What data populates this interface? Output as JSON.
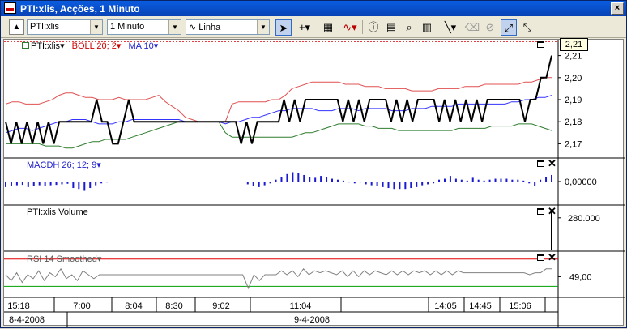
{
  "window": {
    "title": "PTI:xlis, Acções, 1 Minuto",
    "close_label": "×"
  },
  "toolbar": {
    "symbol": "PTI:xlis",
    "interval": "1 Minuto",
    "chart_style": "Linha",
    "chart_style_glyph": "∿"
  },
  "main_pane": {
    "legend": {
      "symbol": "PTI:xlis",
      "boll": "BOLL 20; 2",
      "ma": "MA 10"
    },
    "axis": [
      "2,21",
      "2,20",
      "2,19",
      "2,18",
      "2,17"
    ],
    "last_price": "2,21"
  },
  "macd_pane": {
    "legend": "MACDH 26; 12; 9",
    "axis": [
      "0,00000"
    ]
  },
  "volume_pane": {
    "legend": "PTI:xlis Volume",
    "axis": [
      "280.000"
    ]
  },
  "rsi_pane": {
    "legend": "RSI 14 Smoothed",
    "axis": [
      "49,00"
    ]
  },
  "time_axis": {
    "times": [
      "15:18",
      "7:00",
      "8:04",
      "8:30",
      "9:02",
      "11:04",
      "14:05",
      "14:45",
      "15:06"
    ],
    "dates": [
      "8-4-2008",
      "9-4-2008"
    ]
  },
  "colors": {
    "price": "#000000",
    "boll_upper": "#e05050",
    "boll_lower": "#2e7d2e",
    "ma": "#3333ff",
    "macd": "#1a1ad0",
    "rsi": "#808080",
    "rsi_upper": "#e00000",
    "rsi_lower": "#00a000"
  },
  "chart_data": {
    "type": "line",
    "price_ylim": [
      2.165,
      2.215
    ],
    "price_series": [
      2.18,
      2.17,
      2.18,
      2.17,
      2.18,
      2.17,
      2.18,
      2.17,
      2.18,
      2.17,
      2.18,
      2.18,
      2.18,
      2.18,
      2.18,
      2.18,
      2.18,
      2.19,
      2.18,
      2.18,
      2.17,
      2.17,
      2.18,
      2.19,
      2.18,
      2.18,
      2.18,
      2.18,
      2.18,
      2.18,
      2.18,
      2.18,
      2.18,
      2.18,
      2.18,
      2.18,
      2.18,
      2.18,
      2.18,
      2.18,
      2.18,
      2.18,
      2.18,
      2.18,
      2.17,
      2.18,
      2.17,
      2.18,
      2.18,
      2.18,
      2.18,
      2.18,
      2.19,
      2.18,
      2.19,
      2.18,
      2.19,
      2.19,
      2.19,
      2.19,
      2.19,
      2.19,
      2.19,
      2.18,
      2.19,
      2.18,
      2.19,
      2.18,
      2.19,
      2.19,
      2.19,
      2.19,
      2.18,
      2.19,
      2.18,
      2.19,
      2.18,
      2.19,
      2.19,
      2.19,
      2.19,
      2.18,
      2.19,
      2.18,
      2.19,
      2.18,
      2.19,
      2.18,
      2.19,
      2.18,
      2.19,
      2.19,
      2.19,
      2.19,
      2.19,
      2.19,
      2.19,
      2.18,
      2.19,
      2.19,
      2.2,
      2.2,
      2.21
    ],
    "boll_upper": [
      2.188,
      2.189,
      2.189,
      2.188,
      2.188,
      2.188,
      2.189,
      2.19,
      2.192,
      2.193,
      2.193,
      2.192,
      2.191,
      2.191,
      2.19,
      2.19,
      2.19,
      2.191,
      2.19,
      2.19,
      2.19,
      2.19,
      2.191,
      2.192,
      2.189,
      2.187,
      2.185,
      2.182,
      2.181,
      2.18,
      2.18,
      2.18,
      2.18,
      2.18,
      2.188,
      2.189,
      2.189,
      2.189,
      2.189,
      2.189,
      2.19,
      2.19,
      2.192,
      2.195,
      2.196,
      2.197,
      2.198,
      2.198,
      2.198,
      2.198,
      2.198,
      2.197,
      2.197,
      2.197,
      2.196,
      2.196,
      2.196,
      2.195,
      2.195,
      2.195,
      2.195,
      2.194,
      2.194,
      2.194,
      2.194,
      2.195,
      2.195,
      2.195,
      2.195,
      2.196,
      2.196,
      2.196,
      2.197,
      2.197,
      2.197,
      2.197,
      2.197,
      2.197,
      2.198,
      2.198,
      2.199,
      2.2,
      2.2
    ],
    "boll_lower": [
      2.17,
      2.17,
      2.17,
      2.17,
      2.17,
      2.17,
      2.169,
      2.169,
      2.169,
      2.168,
      2.168,
      2.169,
      2.17,
      2.171,
      2.171,
      2.172,
      2.172,
      2.172,
      2.172,
      2.173,
      2.174,
      2.175,
      2.176,
      2.177,
      2.178,
      2.179,
      2.18,
      2.18,
      2.18,
      2.18,
      2.18,
      2.18,
      2.18,
      2.175,
      2.173,
      2.173,
      2.173,
      2.173,
      2.173,
      2.173,
      2.173,
      2.173,
      2.173,
      2.173,
      2.174,
      2.175,
      2.175,
      2.176,
      2.177,
      2.178,
      2.179,
      2.179,
      2.179,
      2.179,
      2.178,
      2.178,
      2.177,
      2.177,
      2.177,
      2.176,
      2.176,
      2.176,
      2.176,
      2.176,
      2.176,
      2.176,
      2.176,
      2.176,
      2.177,
      2.177,
      2.177,
      2.177,
      2.177,
      2.178,
      2.178,
      2.178,
      2.178,
      2.179,
      2.179,
      2.179,
      2.178,
      2.177,
      2.176
    ],
    "ma": [
      2.175,
      2.176,
      2.177,
      2.177,
      2.176,
      2.177,
      2.178,
      2.179,
      2.18,
      2.18,
      2.181,
      2.181,
      2.181,
      2.18,
      2.179,
      2.179,
      2.179,
      2.18,
      2.18,
      2.181,
      2.181,
      2.181,
      2.181,
      2.181,
      2.181,
      2.181,
      2.181,
      2.18,
      2.18,
      2.18,
      2.18,
      2.18,
      2.18,
      2.179,
      2.18,
      2.18,
      2.181,
      2.182,
      2.182,
      2.183,
      2.184,
      2.185,
      2.185,
      2.186,
      2.186,
      2.186,
      2.186,
      2.185,
      2.185,
      2.185,
      2.186,
      2.186,
      2.186,
      2.185,
      2.186,
      2.186,
      2.186,
      2.186,
      2.185,
      2.185,
      2.185,
      2.186,
      2.186,
      2.186,
      2.187,
      2.187,
      2.187,
      2.187,
      2.188,
      2.188,
      2.188,
      2.188,
      2.188,
      2.188,
      2.188,
      2.188,
      2.189,
      2.189,
      2.19,
      2.19,
      2.191,
      2.191,
      2.192
    ],
    "macd_ylim": [
      -1,
      1
    ],
    "macd_values": [
      -0.3,
      -0.25,
      -0.2,
      -0.18,
      -0.3,
      -0.25,
      -0.2,
      -0.25,
      -0.2,
      -0.18,
      -0.15,
      -0.12,
      -0.35,
      -0.4,
      -0.5,
      -0.35,
      -0.2,
      -0.1,
      -0.05,
      0,
      0,
      0,
      0,
      0,
      0,
      0,
      0,
      0,
      0,
      0,
      0,
      0,
      0,
      0,
      0,
      0,
      0,
      0,
      0,
      0,
      0,
      0,
      0,
      -0.15,
      -0.25,
      -0.3,
      -0.2,
      -0.1,
      0.1,
      0.25,
      0.4,
      0.5,
      0.45,
      0.35,
      0.25,
      0.2,
      0.3,
      0.25,
      0.15,
      0.1,
      0.05,
      -0.05,
      -0.1,
      -0.05,
      -0.15,
      -0.2,
      -0.25,
      -0.3,
      -0.35,
      -0.4,
      -0.4,
      -0.4,
      -0.35,
      -0.3,
      -0.2,
      -0.15,
      -0.1,
      0.1,
      0.15,
      0.3,
      0.15,
      0.1,
      0.05,
      0.2,
      0.1,
      0.05,
      0.1,
      0.15,
      0.15,
      0.15,
      0.1,
      0.1,
      0.05,
      -0.1,
      -0.25,
      0.1,
      0.25,
      0.35
    ],
    "volume_ylim": [
      0,
      350000
    ],
    "volume_bars": [
      0,
      0,
      0,
      0,
      0,
      0,
      0,
      0,
      0,
      0,
      0,
      0,
      0,
      0,
      0,
      0,
      0,
      0,
      0,
      0,
      0,
      0,
      0,
      0,
      0,
      0,
      0,
      0,
      0,
      0,
      0,
      0,
      0,
      0,
      0,
      0,
      0,
      0,
      0,
      0,
      0,
      0,
      0,
      0,
      0,
      0,
      0,
      0,
      0,
      0,
      0,
      0,
      0,
      0,
      0,
      0,
      0,
      0,
      0,
      0,
      0,
      0,
      0,
      0,
      0,
      0,
      0,
      0,
      0,
      0,
      0,
      0,
      0,
      0,
      0,
      0,
      0,
      0,
      0,
      0,
      0,
      0,
      0,
      0,
      0,
      0,
      0,
      0,
      0,
      0,
      0,
      0,
      0,
      0,
      0,
      0,
      0,
      0,
      0,
      0,
      0,
      340000
    ],
    "rsi_ylim": [
      40,
      60
    ],
    "rsi_upper_level": 58,
    "rsi_lower_level": 44,
    "rsi_values": [
      50,
      47,
      51,
      46,
      50,
      48,
      52,
      47,
      51,
      49,
      53,
      48,
      50,
      47,
      52,
      50,
      48,
      50,
      50,
      50,
      50,
      50,
      50,
      50,
      50,
      50,
      50,
      50,
      50,
      50,
      50,
      50,
      50,
      50,
      50,
      50,
      50,
      50,
      50,
      50,
      50,
      50,
      50,
      50,
      43,
      50,
      47,
      50,
      50,
      50,
      52,
      50,
      52,
      49,
      53,
      50,
      52,
      51,
      52,
      51,
      50,
      52,
      49,
      52,
      49,
      52,
      50,
      52,
      51,
      50,
      52,
      50,
      52,
      50,
      52,
      51,
      52,
      50,
      52,
      50,
      52,
      50,
      52,
      51,
      51,
      51,
      51,
      51,
      51,
      51,
      51,
      51,
      51,
      51,
      51,
      50,
      51,
      51,
      53,
      53
    ]
  }
}
